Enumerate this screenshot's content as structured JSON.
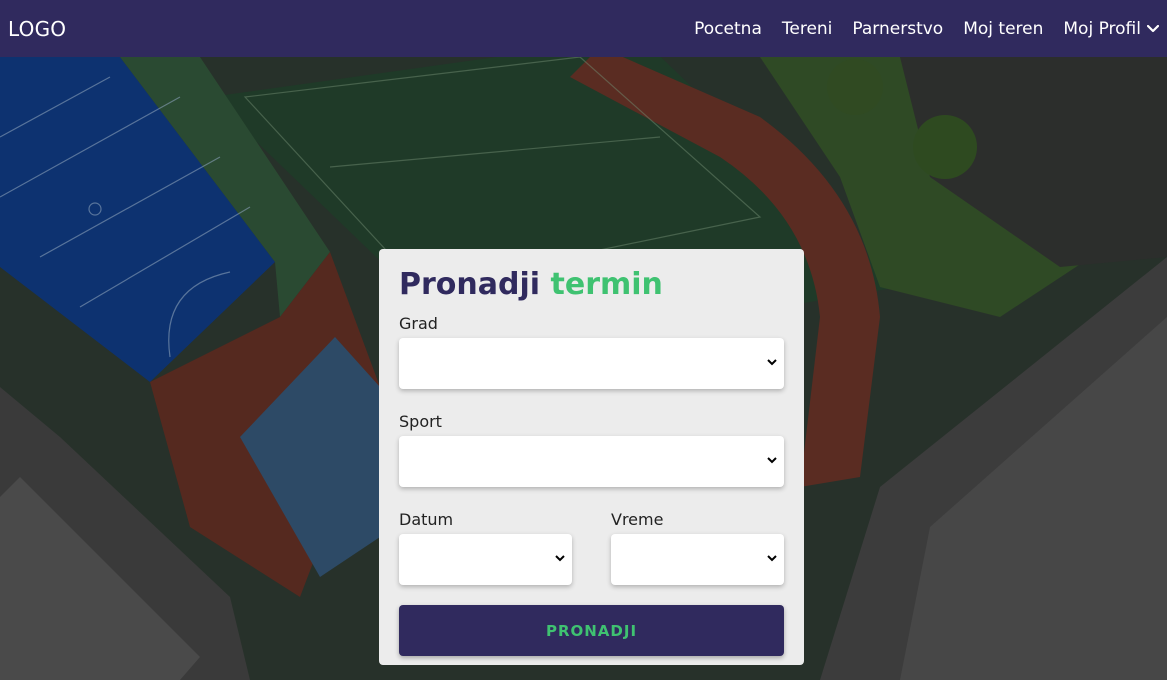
{
  "navbar": {
    "logo": "LOGO",
    "links": [
      "Pocetna",
      "Tereni",
      "Parnerstvo",
      "Moj teren"
    ],
    "profile_label": "Moj Profil",
    "profile_icon": "chevron-down-icon"
  },
  "card": {
    "title_main": "Pronadji",
    "title_accent": "termin",
    "fields": {
      "grad": {
        "label": "Grad",
        "value": ""
      },
      "sport": {
        "label": "Sport",
        "value": ""
      },
      "datum": {
        "label": "Datum",
        "value": ""
      },
      "vreme": {
        "label": "Vreme",
        "value": ""
      }
    },
    "submit_label": "PRONADJI"
  },
  "colors": {
    "navbar": "#302a5e",
    "accent": "#3fc271",
    "card_bg": "#ececec",
    "button_bg": "#302a5e"
  }
}
